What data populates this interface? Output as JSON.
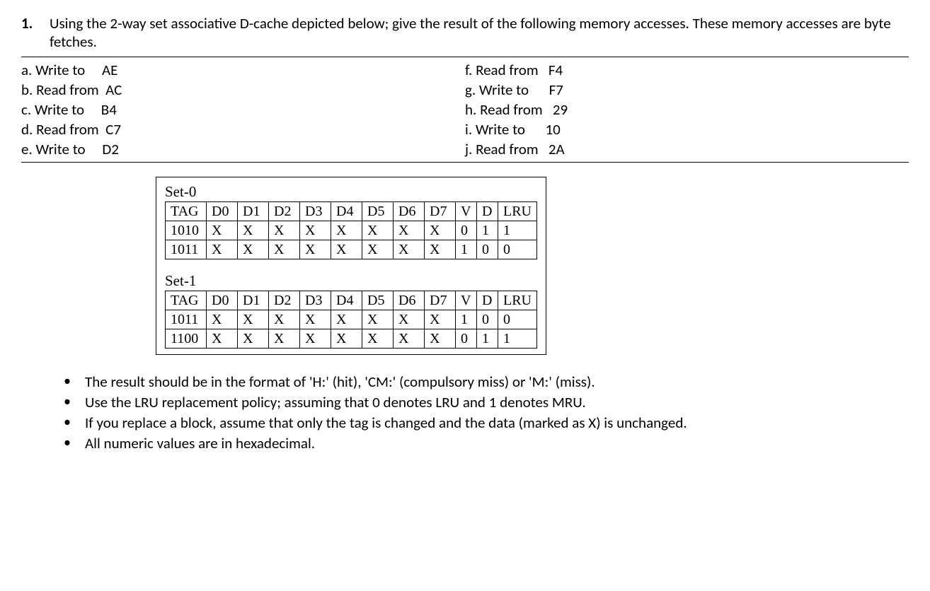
{
  "question": {
    "number": "1.",
    "text": "Using the 2-way set associative D-cache depicted below; give the result of the following memory accesses. These memory accesses are byte fetches."
  },
  "accesses": {
    "left": [
      {
        "label": "a. Write to",
        "addr": "AE"
      },
      {
        "label": "b. Read from",
        "addr": "AC"
      },
      {
        "label": "c. Write to",
        "addr": "B4"
      },
      {
        "label": "d. Read from",
        "addr": "C7"
      },
      {
        "label": "e. Write to",
        "addr": "D2"
      }
    ],
    "right": [
      {
        "label": "f. Read from",
        "addr": "F4"
      },
      {
        "label": "g. Write to",
        "addr": "F7"
      },
      {
        "label": "h. Read from",
        "addr": "29"
      },
      {
        "label": "i. Write to",
        "addr": "10"
      },
      {
        "label": "j. Read from",
        "addr": "2A"
      }
    ]
  },
  "cache": {
    "headers": [
      "TAG",
      "D0",
      "D1",
      "D2",
      "D3",
      "D4",
      "D5",
      "D6",
      "D7",
      "V",
      "D",
      "LRU"
    ],
    "sets": [
      {
        "label": "Set-0",
        "rows": [
          {
            "tag": "1010",
            "d": [
              "X",
              "X",
              "X",
              "X",
              "X",
              "X",
              "X",
              "X"
            ],
            "v": "0",
            "dirty": "1",
            "lru": "1"
          },
          {
            "tag": "1011",
            "d": [
              "X",
              "X",
              "X",
              "X",
              "X",
              "X",
              "X",
              "X"
            ],
            "v": "1",
            "dirty": "0",
            "lru": "0"
          }
        ]
      },
      {
        "label": "Set-1",
        "rows": [
          {
            "tag": "1011",
            "d": [
              "X",
              "X",
              "X",
              "X",
              "X",
              "X",
              "X",
              "X"
            ],
            "v": "1",
            "dirty": "0",
            "lru": "0"
          },
          {
            "tag": "1100",
            "d": [
              "X",
              "X",
              "X",
              "X",
              "X",
              "X",
              "X",
              "X"
            ],
            "v": "0",
            "dirty": "1",
            "lru": "1"
          }
        ]
      }
    ]
  },
  "notes": [
    "The result should be in the format of 'H:' (hit), 'CM:' (compulsory miss) or 'M:' (miss).",
    "Use the LRU replacement policy; assuming that 0 denotes LRU and 1 denotes MRU.",
    "If you replace a block, assume that only the tag is changed and the data (marked as X) is unchanged.",
    "All numeric values are in hexadecimal."
  ]
}
